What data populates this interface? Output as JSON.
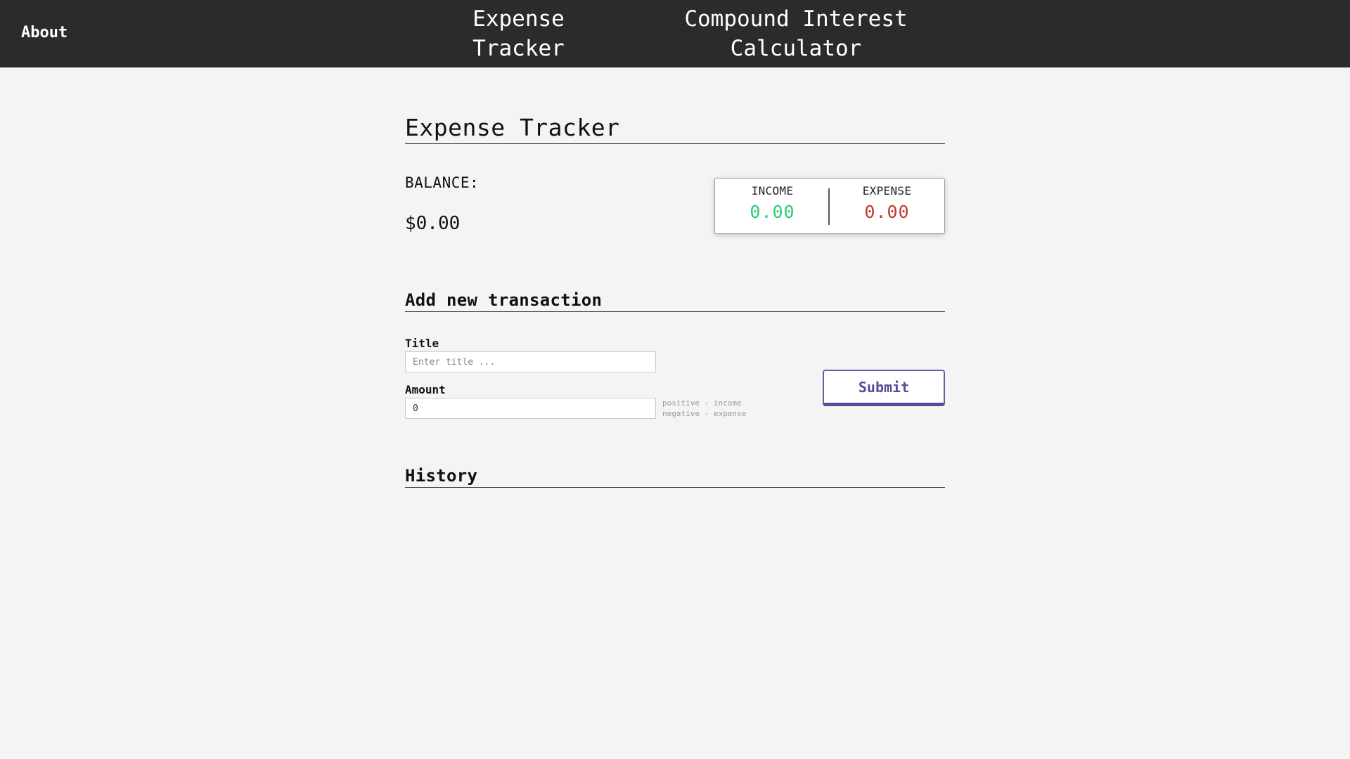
{
  "nav": {
    "about": "About",
    "expense_tracker": "Expense\nTracker",
    "compound_interest": "Compound Interest\nCalculator"
  },
  "page": {
    "title": "Expense Tracker",
    "balance_label": "BALANCE:",
    "balance_value": "$0.00"
  },
  "summary": {
    "income_label": "INCOME",
    "income_value": "0.00",
    "expense_label": "EXPENSE",
    "expense_value": "0.00"
  },
  "form": {
    "heading": "Add new transaction",
    "title_label": "Title",
    "title_placeholder": "Enter title ...",
    "title_value": "",
    "amount_label": "Amount",
    "amount_value": "0",
    "hint_line1": "positive - income",
    "hint_line2": "negative - expense",
    "submit_label": "Submit"
  },
  "history": {
    "heading": "History"
  },
  "colors": {
    "navbar_bg": "#2b2b2b",
    "income": "#2ecc71",
    "expense": "#c0392b",
    "accent": "#5b4a98"
  }
}
